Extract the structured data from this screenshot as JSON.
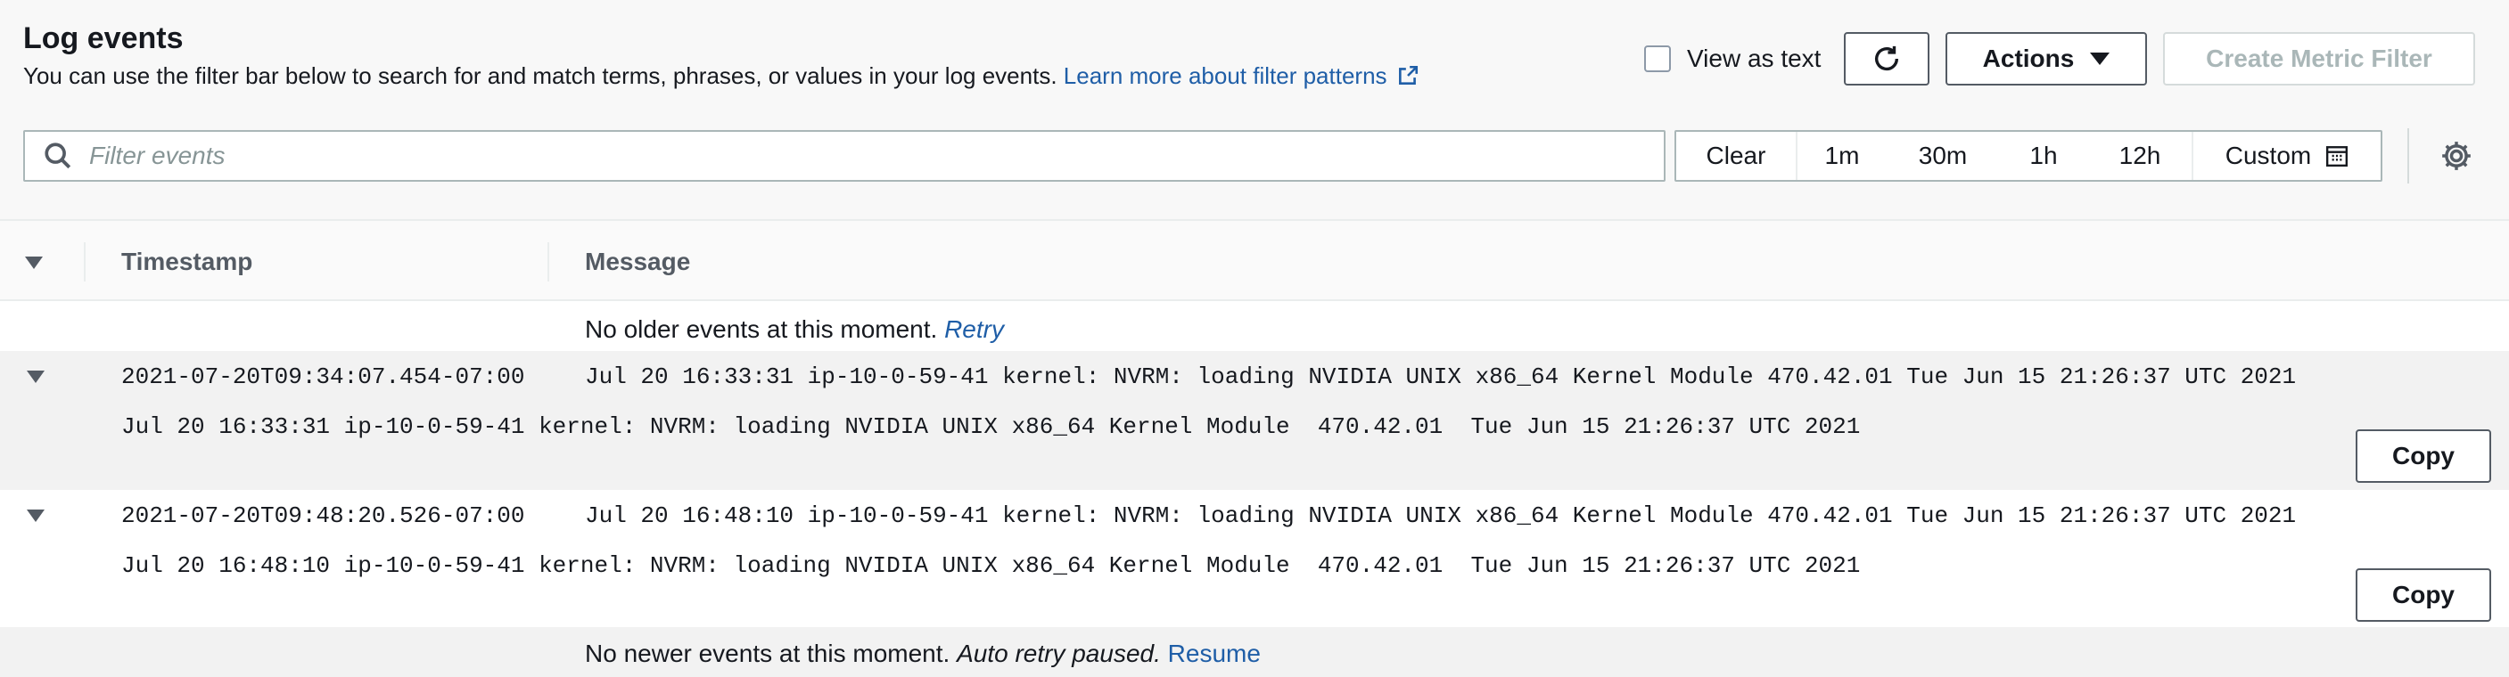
{
  "header": {
    "title": "Log events",
    "subtitle": "You can use the filter bar below to search for and match terms, phrases, or values in your log events.",
    "learn_more": "Learn more about filter patterns",
    "view_as_text": "View as text",
    "actions_label": "Actions",
    "create_metric_filter": "Create Metric Filter"
  },
  "filter": {
    "placeholder": "Filter events",
    "time": {
      "clear": "Clear",
      "m1": "1m",
      "m30": "30m",
      "h1": "1h",
      "h12": "12h",
      "custom": "Custom"
    }
  },
  "table": {
    "col_timestamp": "Timestamp",
    "col_message": "Message",
    "older_text": "No older events at this moment.",
    "older_retry": "Retry",
    "newer_text": "No newer events at this moment.",
    "newer_paused": "Auto retry paused.",
    "newer_resume": "Resume",
    "copy_label": "Copy",
    "rows": [
      {
        "timestamp": "2021-07-20T09:34:07.454-07:00",
        "message": "Jul 20 16:33:31 ip-10-0-59-41 kernel: NVRM: loading NVIDIA UNIX x86_64 Kernel Module 470.42.01 Tue Jun 15 21:26:37 UTC 2021",
        "detail": "Jul 20 16:33:31 ip-10-0-59-41 kernel: NVRM: loading NVIDIA UNIX x86_64 Kernel Module  470.42.01  Tue Jun 15 21:26:37 UTC 2021"
      },
      {
        "timestamp": "2021-07-20T09:48:20.526-07:00",
        "message": "Jul 20 16:48:10 ip-10-0-59-41 kernel: NVRM: loading NVIDIA UNIX x86_64 Kernel Module 470.42.01 Tue Jun 15 21:26:37 UTC 2021",
        "detail": "Jul 20 16:48:10 ip-10-0-59-41 kernel: NVRM: loading NVIDIA UNIX x86_64 Kernel Module  470.42.01  Tue Jun 15 21:26:37 UTC 2021"
      }
    ]
  },
  "icons": {
    "external": "external-link-icon",
    "refresh": "refresh-icon",
    "search": "search-icon",
    "calendar": "calendar-icon",
    "settings": "gear-icon"
  },
  "colors": {
    "link": "#1f5ea7",
    "row_alt": "#f2f2f2"
  }
}
